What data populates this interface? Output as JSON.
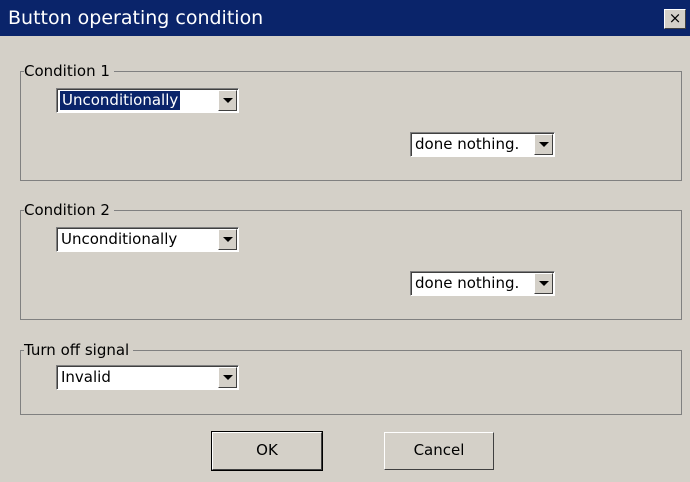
{
  "dialog": {
    "title": "Button operating condition",
    "close_glyph": "×"
  },
  "condition1": {
    "label": "Condition 1",
    "condition_value": "Unconditionally",
    "action_value": "done nothing."
  },
  "condition2": {
    "label": "Condition 2",
    "condition_value": "Unconditionally",
    "action_value": "done nothing."
  },
  "turn_off": {
    "label": "Turn off signal",
    "value": "Invalid"
  },
  "buttons": {
    "ok_label": "OK",
    "cancel_label": "Cancel"
  },
  "colors": {
    "titlebar": "#0a246a",
    "dialog_bg": "#d4d0c8",
    "selection": "#0a246a"
  },
  "icons": {
    "close": "close-icon",
    "dropdown": "chevron-down-icon"
  }
}
